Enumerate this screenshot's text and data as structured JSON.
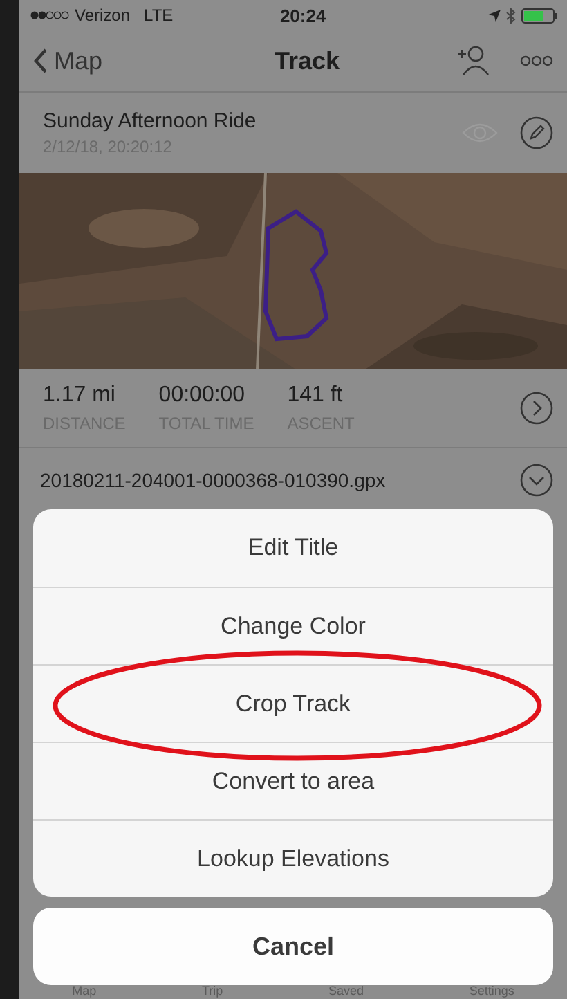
{
  "status_bar": {
    "carrier": "Verizon",
    "network": "LTE",
    "time": "20:24"
  },
  "nav": {
    "back": "Map",
    "title": "Track"
  },
  "track": {
    "name": "Sunday Afternoon Ride",
    "date": "2/12/18, 20:20:12"
  },
  "stats": [
    {
      "value": "1.17 mi",
      "label": "DISTANCE"
    },
    {
      "value": "00:00:00",
      "label": "TOTAL TIME"
    },
    {
      "value": "141 ft",
      "label": "ASCENT"
    }
  ],
  "file": {
    "name": "20180211-204001-0000368-010390.gpx"
  },
  "action_sheet": {
    "items": [
      {
        "label": "Edit Title",
        "highlighted": false
      },
      {
        "label": "Change Color",
        "highlighted": false
      },
      {
        "label": "Crop Track",
        "highlighted": true
      },
      {
        "label": "Convert to area",
        "highlighted": false
      },
      {
        "label": "Lookup Elevations",
        "highlighted": false
      }
    ],
    "cancel": "Cancel"
  },
  "tab_bar": [
    {
      "label": "Map"
    },
    {
      "label": "Trip"
    },
    {
      "label": "Saved"
    },
    {
      "label": "Settings"
    }
  ]
}
